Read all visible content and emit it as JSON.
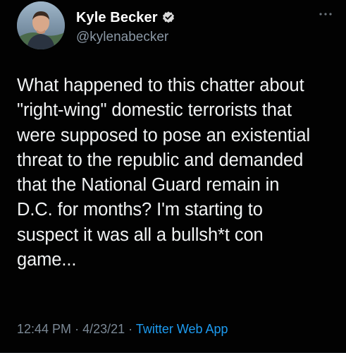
{
  "author": {
    "display_name": "Kyle Becker",
    "handle": "@kylenabecker",
    "verified": true,
    "avatar_icon": "profile-photo"
  },
  "tweet": {
    "text": "What happened to this chatter about\n\"right-wing\" domestic terrorists that\nwere supposed to pose an existential\nthreat to the republic and demanded\nthat the National Guard remain in\nD.C. for months? I'm starting to\nsuspect it was all a bullsh*t con\ngame...",
    "time": "12:44 PM",
    "date": "4/23/21",
    "separator": "·",
    "source": "Twitter Web App"
  },
  "more_menu": {
    "icon": "more-icon"
  },
  "colors": {
    "background": "#000000",
    "text": "#f1f3f4",
    "muted": "#8b98a5",
    "link": "#1d9bf0",
    "verified_badge": "#1d9bf0"
  }
}
